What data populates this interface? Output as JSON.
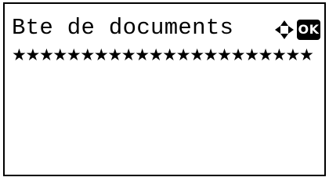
{
  "screen": {
    "title": "Bte de documents",
    "ok_label": "OK",
    "separator": "★★★★★★★★★★★★★★★★★★★★★★"
  },
  "icons": {
    "navigation": "four-way-arrow-icon",
    "ok": "ok-key-icon"
  }
}
